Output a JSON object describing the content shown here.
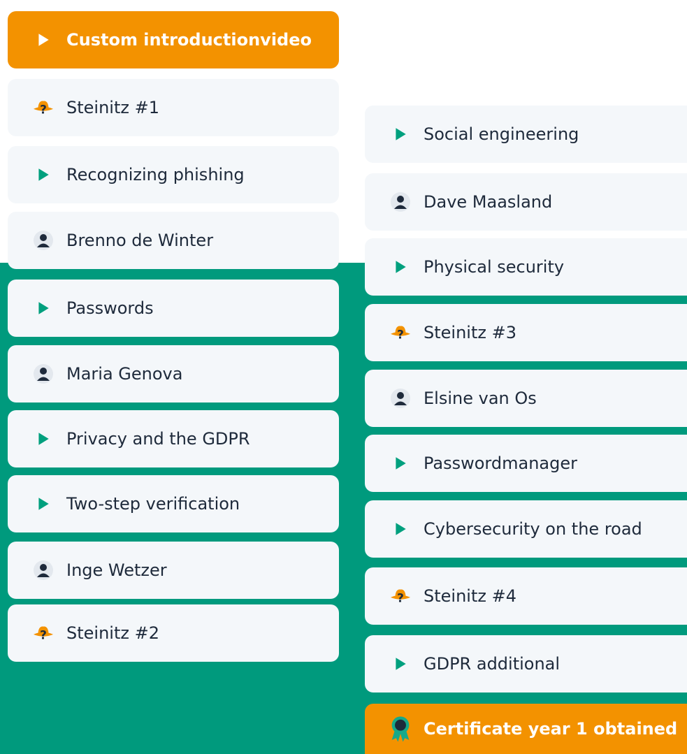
{
  "colors": {
    "accent": "#f39200",
    "green": "#009a7d",
    "card": "#f4f7fa",
    "text": "#1e2a3b"
  },
  "left_items": [
    {
      "label": "Custom introductionvideo",
      "icon": "play-icon",
      "active": true
    },
    {
      "label": "Steinitz #1",
      "icon": "detective-hat-icon"
    },
    {
      "label": "Recognizing phishing",
      "icon": "play-icon"
    },
    {
      "label": "Brenno de Winter",
      "icon": "person-icon"
    },
    {
      "label": "Passwords",
      "icon": "play-icon"
    },
    {
      "label": "Maria Genova",
      "icon": "person-icon"
    },
    {
      "label": "Privacy and the GDPR",
      "icon": "play-icon"
    },
    {
      "label": "Two-step verification",
      "icon": "play-icon"
    },
    {
      "label": "Inge Wetzer",
      "icon": "person-icon"
    },
    {
      "label": "Steinitz #2",
      "icon": "detective-hat-icon"
    }
  ],
  "right_items": [
    {
      "label": "Social engineering",
      "icon": "play-icon"
    },
    {
      "label": "Dave Maasland",
      "icon": "person-icon"
    },
    {
      "label": "Physical security",
      "icon": "play-icon"
    },
    {
      "label": "Steinitz #3",
      "icon": "detective-hat-icon"
    },
    {
      "label": "Elsine van Os",
      "icon": "person-icon"
    },
    {
      "label": "Passwordmanager",
      "icon": "play-icon"
    },
    {
      "label": "Cybersecurity on the road",
      "icon": "play-icon"
    },
    {
      "label": "Steinitz #4",
      "icon": "detective-hat-icon"
    },
    {
      "label": "GDPR additional",
      "icon": "play-icon"
    },
    {
      "label": "Certificate year 1 obtained",
      "icon": "award-ribbon-icon",
      "active": true
    }
  ]
}
